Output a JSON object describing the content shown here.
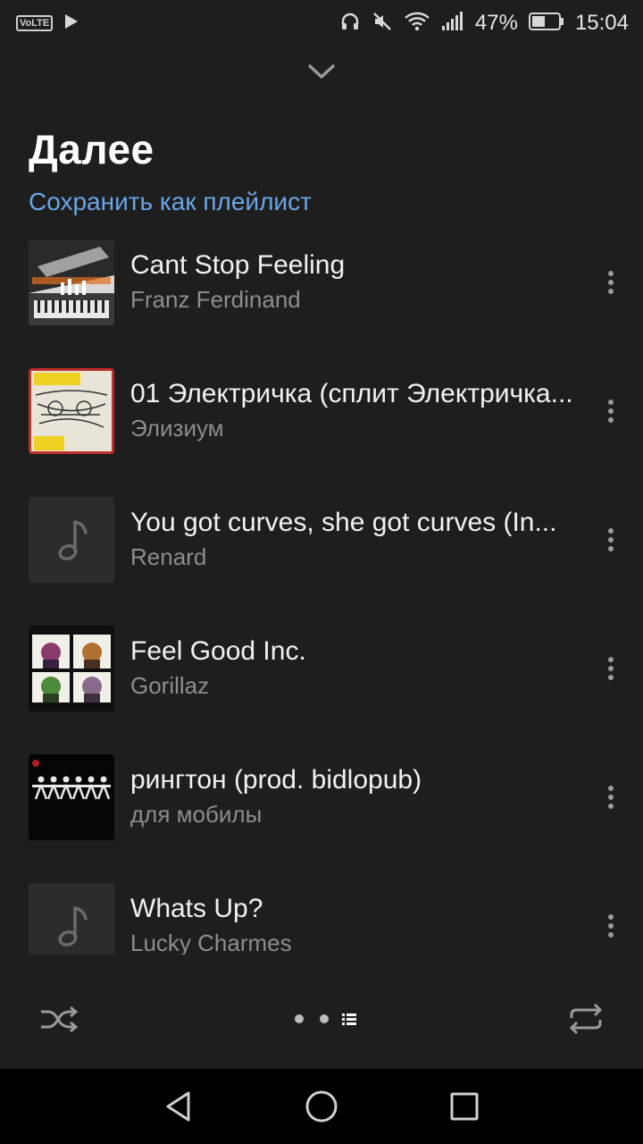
{
  "status_bar": {
    "volte": "VoLTE",
    "battery": "47%",
    "time": "15:04"
  },
  "header": {
    "title": "Далее",
    "save_playlist": "Сохранить как плейлист"
  },
  "queue": [
    {
      "title": "Cant Stop Feeling",
      "artist": "Franz Ferdinand",
      "art": "franz-ferdinand-cover"
    },
    {
      "title": "01 Электричка (сплит Электричка...",
      "artist": "Элизиум",
      "art": "elizium-cover"
    },
    {
      "title": "You got curves, she got curves (In...",
      "artist": "Renard",
      "art": "music-note-placeholder"
    },
    {
      "title": "Feel Good Inc.",
      "artist": "Gorillaz",
      "art": "gorillaz-cover"
    },
    {
      "title": "рингтон (prod. bidlopub)",
      "artist": "для мобилы",
      "art": "dark-figures-cover"
    },
    {
      "title": "Whats Up?",
      "artist": "Lucky Charmes",
      "art": "music-note-placeholder"
    }
  ],
  "colors": {
    "background": "#1e1e1e",
    "accent_link": "#6aa6e6",
    "secondary_text": "#8d8d8d"
  }
}
